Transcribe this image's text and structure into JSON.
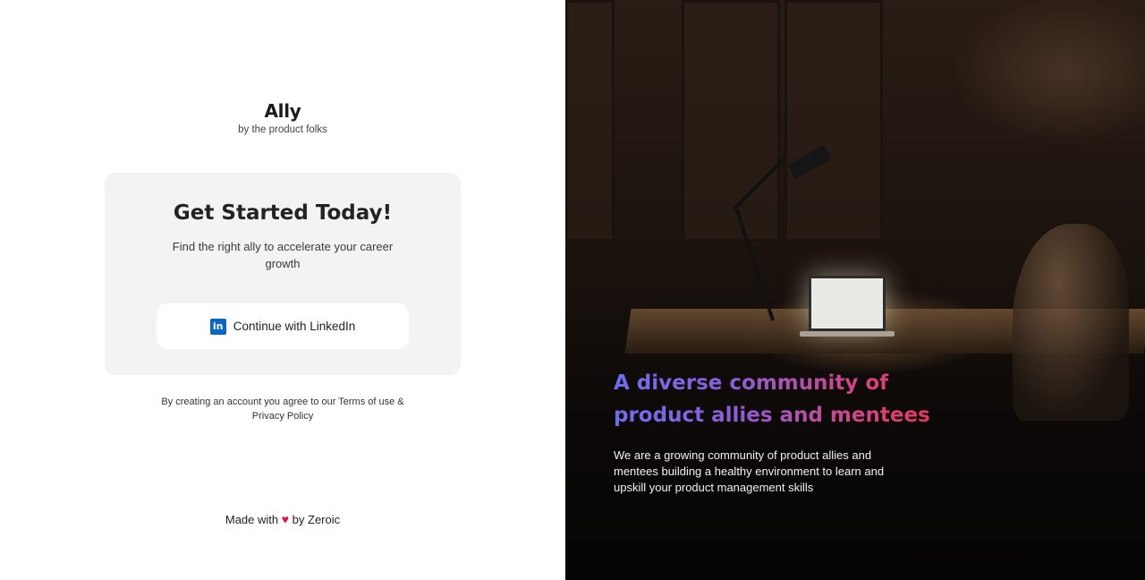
{
  "brand": {
    "name": "Ally",
    "tagline": "by the product folks"
  },
  "signup_card": {
    "title": "Get Started Today!",
    "subtitle": "Find the right ally to accelerate your career growth",
    "linkedin_button": {
      "icon": "linkedin-icon",
      "icon_text": "in",
      "label": "Continue with LinkedIn"
    }
  },
  "terms": {
    "prefix": "By creating an account you agree to our ",
    "terms_link": "Terms of use",
    "joiner": " & ",
    "privacy_link": "Privacy Policy"
  },
  "footer": {
    "prefix": "Made with ",
    "heart_icon": "heart-icon",
    "heart_glyph": "♥",
    "suffix": " by Zeroic"
  },
  "hero": {
    "headline": "A diverse community of product allies and mentees",
    "description": "We are a growing community of product allies and mentees building a healthy environment to learn and upskill your product management skills",
    "headline_gradient": [
      "#6f6df0",
      "#8a5fd8",
      "#d0468a",
      "#e6364a"
    ]
  },
  "colors": {
    "linkedin_blue": "#0a66c2",
    "heart_red": "#d7194a",
    "card_background": "#f3f3f3"
  }
}
